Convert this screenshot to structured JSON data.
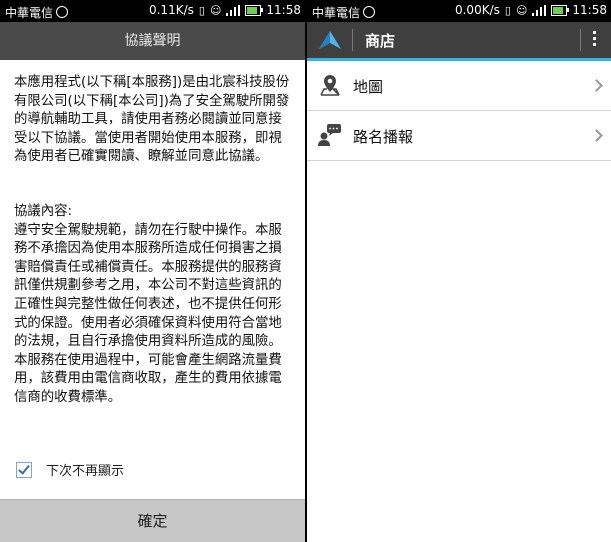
{
  "left": {
    "status": {
      "carrier": "中華電信",
      "speed": "0.11K/s",
      "time": "11:58"
    },
    "dialog": {
      "title": "協議聲明",
      "intro": "本應用程式(以下稱[本服務])是由北宸科技股份有限公司(以下稱[本公司])為了安全駕駛所開發的導航輔助工具，請使用者務必閱讀並同意接受以下協議。當使用者開始使用本服務，即視為使用者已確實閱讀、瞭解並同意此協議。",
      "content_heading": "協議內容:",
      "content": "遵守安全駕駛規範，請勿在行駛中操作。本服務不承擔因為使用本服務所造成任何損害之損害賠償責任或補償責任。本服務提供的服務資訊僅供規劃參考之用，本公司不對這些資訊的正確性與完整性做任何表述，也不提供任何形式的保證。使用者必須確保資料使用符合當地的法規，且自行承擔使用資料所造成的風險。本服務在使用過程中，可能會產生網路流量費用，該費用由電信商收取，產生的費用依據電信商的收費標準。",
      "checkbox_label": "下次不再顯示",
      "confirm_label": "確定"
    }
  },
  "right": {
    "status": {
      "carrier": "中華電信",
      "speed": "0.00K/s",
      "time": "11:58"
    },
    "appbar": {
      "title": "商店"
    },
    "items": [
      {
        "label": "地圖",
        "icon": "map-pin-icon"
      },
      {
        "label": "路名播報",
        "icon": "speech-person-icon"
      }
    ],
    "colors": {
      "accent": "#33b5e5",
      "appbar": "#3f3f3f"
    }
  }
}
